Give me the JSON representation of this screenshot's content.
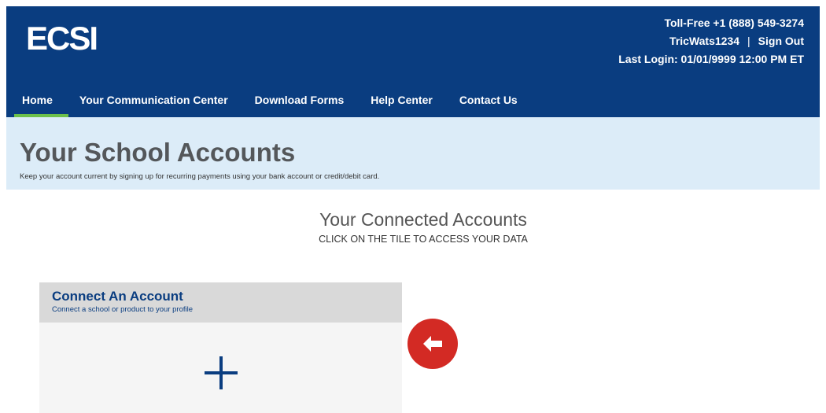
{
  "header": {
    "logo": "ECSI",
    "phone": "Toll-Free +1 (888) 549-3274",
    "username": "TricWats1234",
    "separator": "|",
    "sign_out": "Sign Out",
    "last_login": "Last Login: 01/01/9999 12:00 PM ET"
  },
  "nav": {
    "items": [
      {
        "label": "Home",
        "active": true
      },
      {
        "label": "Your Communication Center"
      },
      {
        "label": "Download Forms"
      },
      {
        "label": "Help Center"
      },
      {
        "label": "Contact Us"
      }
    ]
  },
  "page": {
    "title": "Your School Accounts",
    "subtitle": "Keep your account current by signing up for recurring payments using your bank account or credit/debit card."
  },
  "connected": {
    "title": "Your Connected Accounts",
    "instruction": "CLICK ON THE TILE TO ACCESS YOUR DATA"
  },
  "tile": {
    "title": "Connect An Account",
    "description": "Connect a school or product to your profile",
    "icon": "plus-icon"
  },
  "arrow": {
    "icon": "arrow-left-icon"
  },
  "colors": {
    "brand_blue": "#0a3d80",
    "nav_active": "#6cc04a",
    "title_band": "#dcecf8",
    "arrow_red": "#d32a24"
  }
}
